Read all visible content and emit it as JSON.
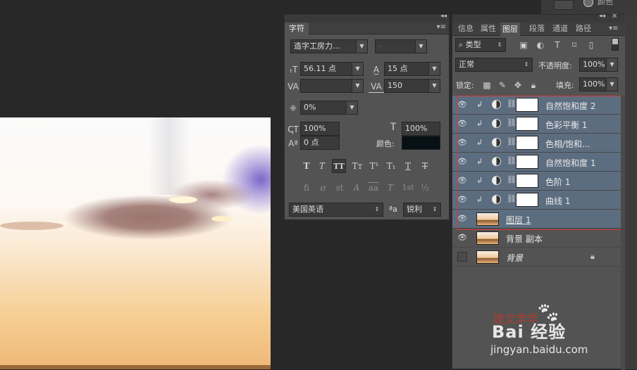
{
  "character_panel": {
    "title": "字符",
    "font_family": "造字工房力...",
    "font_style": "-",
    "font_size": "56.11 点",
    "leading": "15 点",
    "kerning": "",
    "tracking": "150",
    "tsume": "0%",
    "vertical_scale": "100%",
    "horizontal_scale": "100%",
    "baseline_shift": "0 点",
    "color_label": "颜色:",
    "color": "#071014",
    "style_buttons": [
      "T",
      "T",
      "TT",
      "Tт",
      "T¹",
      "T₁",
      "T",
      "T"
    ],
    "opentype_buttons": [
      "fi",
      "ơ",
      "st",
      "A",
      "aa",
      "T",
      "1st",
      "½"
    ],
    "language": "美国英语",
    "aa_icon": "ªa",
    "antialias": "锐利"
  },
  "layers_panel": {
    "tabs": [
      "信息",
      "属性",
      "图层",
      "段落",
      "通道",
      "路径"
    ],
    "active_tab": "图层",
    "filter_kind": "类型",
    "blend_mode": "正常",
    "opacity_label": "不透明度:",
    "opacity": "100%",
    "lock_label": "锁定:",
    "fill_label": "填充:",
    "fill": "100%",
    "layers": [
      {
        "name": "自然饱和度 2",
        "type": "adjustment",
        "selected": true,
        "visible": true
      },
      {
        "name": "色彩平衡 1",
        "type": "adjustment",
        "selected": true,
        "visible": true
      },
      {
        "name": "色相/饱和...",
        "type": "adjustment",
        "selected": true,
        "visible": true
      },
      {
        "name": "自然饱和度 1",
        "type": "adjustment",
        "selected": true,
        "visible": true
      },
      {
        "name": "色阶 1",
        "type": "adjustment",
        "selected": true,
        "visible": true
      },
      {
        "name": "曲线 1",
        "type": "adjustment",
        "selected": true,
        "visible": true
      },
      {
        "name": "图层 1",
        "type": "pixel",
        "selected": true,
        "visible": true
      },
      {
        "name": "背景 副本",
        "type": "pixel",
        "selected": false,
        "visible": true
      },
      {
        "name": "背景",
        "type": "background",
        "selected": false,
        "visible": false
      }
    ]
  },
  "right_dock": {
    "label": "颜色"
  },
  "watermark": {
    "red_text": "建文学学",
    "logo_text": "Bai 经验",
    "url": "jingyan.baidu.com"
  },
  "colors": {
    "selection_outline": "#d23a3a",
    "selected_row": "#5d6d80",
    "panel_bg": "#535353"
  }
}
